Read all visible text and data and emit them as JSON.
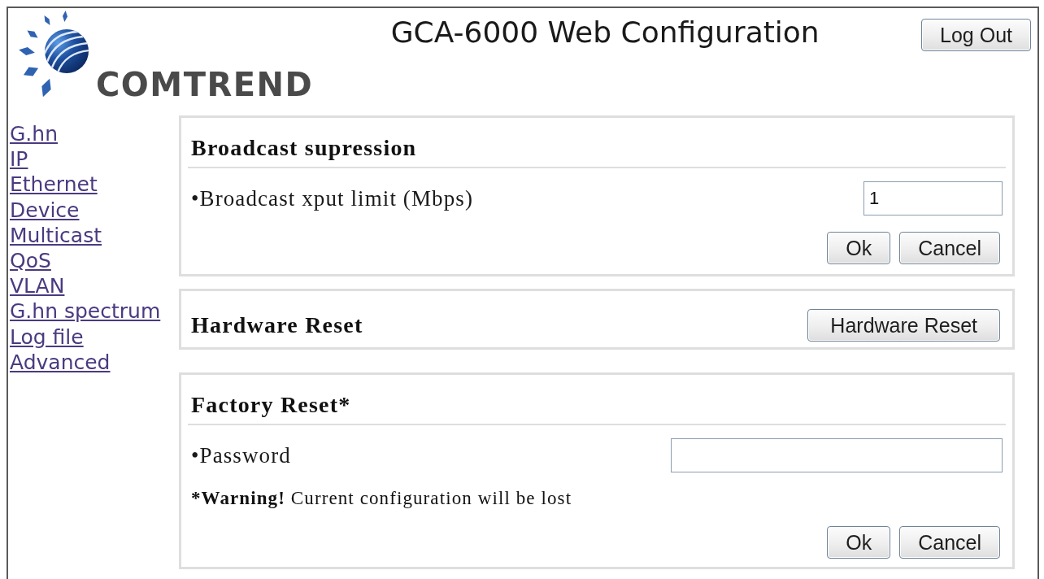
{
  "header": {
    "logo_text": "COMTREND",
    "title": "GCA-6000 Web Configuration",
    "logout_button": "Log Out"
  },
  "sidebar": {
    "links": [
      "G.hn",
      "IP",
      "Ethernet",
      "Device",
      "Multicast",
      "QoS",
      "VLAN",
      "G.hn spectrum",
      "Log file",
      "Advanced"
    ]
  },
  "sections": [
    {
      "kind": "form",
      "title": "Broadcast supression",
      "fields": [
        {
          "label": "•Broadcast xput limit (Mbps)",
          "value": "1"
        }
      ],
      "buttons": [
        "Ok",
        "Cancel"
      ]
    },
    {
      "kind": "action",
      "title": "Hardware Reset",
      "button": "Hardware Reset"
    },
    {
      "kind": "form",
      "title": "Factory Reset*",
      "fields": [
        {
          "label": "•Password"
        }
      ],
      "note": {
        "emphasis": "*Warning!",
        "text": "Current configuration will be lost"
      },
      "buttons": [
        "Ok",
        "Cancel"
      ]
    }
  ]
}
